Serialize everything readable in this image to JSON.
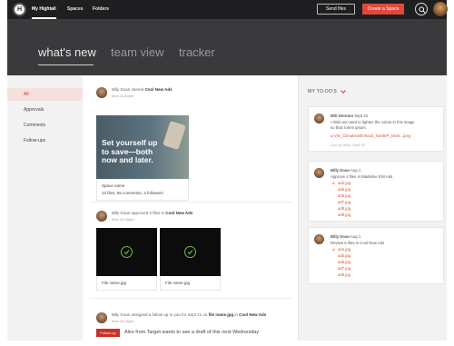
{
  "topbar": {
    "logo_glyph": "H",
    "nav": [
      "My Hightail",
      "Spaces",
      "Folders"
    ],
    "send_files": "Send files",
    "create_space": "Create a Space"
  },
  "hero": {
    "tabs": [
      "what's new",
      "team view",
      "tracker"
    ]
  },
  "sidebar": {
    "items": [
      "All",
      "Approvals",
      "Comments",
      "Follow-ups"
    ]
  },
  "feed": [
    {
      "user": "Billy Doan",
      "action": "shared",
      "target": "Cool New Ads",
      "time": "Mon 11:30pm",
      "promo_text": "Set yourself up to save—both now and later.",
      "space_name": "Space name",
      "stats": "22 files, 55 comments, 3 followers"
    },
    {
      "user": "Billy Doan",
      "action": "approved 2 files in",
      "target": "Cool New Ads",
      "time": "Mon 10:45pm",
      "files": [
        "File name.jpg",
        "File name.jpg"
      ]
    },
    {
      "user": "Billy Doan",
      "action_prefix": "assigned a follow up to you for Sept 21 on",
      "file": "file name.jpg",
      "in_word": "in",
      "target": "Cool New Ads",
      "time": "Mon 10:45pm",
      "badge": "Follow-up",
      "message": "Alex from Target wants to see a draft of this next Wednesday"
    }
  ],
  "todos": {
    "header": "MY TO-DO'S",
    "items": [
      {
        "user": "Mitt Dermon",
        "date": "Sept 22",
        "lines": [
          "I think we need to lighten the colors in this image",
          "so that: lorem ipsum."
        ],
        "link": "VW_Climatewithe0ood_NonBIP_Desk...jpeg",
        "due": "Due by Wed, Sept 30"
      },
      {
        "user": "Billy Doan",
        "date": "Aug 1",
        "line": "Approve 4 files in Madeline ENI Ads",
        "files": [
          "ad4.jpg",
          "ad5.jpg",
          "ad6.jpg",
          "ad7.jpg",
          "ad8.jpg",
          "ad9.jpg"
        ]
      },
      {
        "user": "Billy Doan",
        "date": "Aug 1",
        "line": "Review 5 files in Cool New Ads",
        "files": [
          "ad4.jpg",
          "ad5.jpg",
          "ad6.jpg",
          "ad7.jpg",
          "ad8.jpg"
        ]
      }
    ]
  },
  "colors": {
    "accent": "#e0483a",
    "link": "#d65a2e",
    "topbar": "#1f1f21",
    "hero": "#3a3a3d",
    "check": "#6fbf3b"
  },
  "icons": {
    "search": "search-icon",
    "check": "checkmark-icon",
    "chevron": "chevron-down-icon",
    "clip": "paperclip-icon"
  }
}
